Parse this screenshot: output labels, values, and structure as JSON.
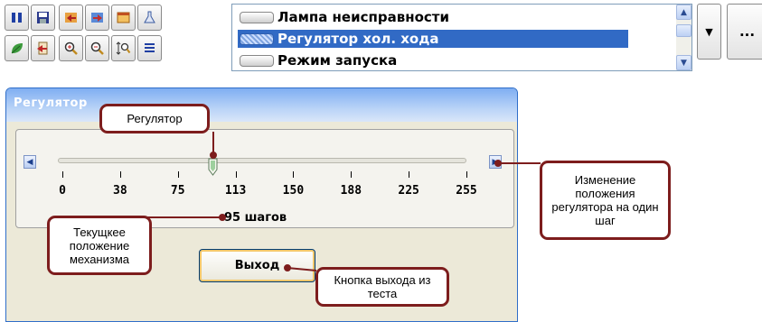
{
  "toolbar": {
    "row1": [
      "pause-icon",
      "save-icon",
      "prev-icon",
      "next-icon",
      "window-icon",
      "flask-icon"
    ],
    "row2": [
      "leaf-icon",
      "export-icon",
      "zoom-in-icon",
      "zoom-out-icon",
      "zoom-fit-icon",
      "list-icon"
    ]
  },
  "signals": {
    "items": [
      {
        "label": "Лампа неисправности",
        "selected": false
      },
      {
        "label": "Регулятор хол. хода",
        "selected": true
      },
      {
        "label": "Режим запуска",
        "selected": false
      }
    ]
  },
  "dropdown_glyph": "▼",
  "more_label": "...",
  "dialog": {
    "title": "Регулятор",
    "scale_labels": [
      "0",
      "38",
      "75",
      "113",
      "150",
      "188",
      "225",
      "255"
    ],
    "slider": {
      "min": 0,
      "max": 255,
      "value": 95
    },
    "position_text": "95 шагов",
    "exit_label": "Выход"
  },
  "callouts": {
    "regulator": "Регулятор",
    "step_change": "Изменение положения регулятора на один шаг",
    "current_position": "Текущкее положение механизма",
    "exit_button": "Кнопка выхода из теста"
  },
  "colors": {
    "accent": "#316ac5",
    "callout_border": "#7d1d1d"
  }
}
